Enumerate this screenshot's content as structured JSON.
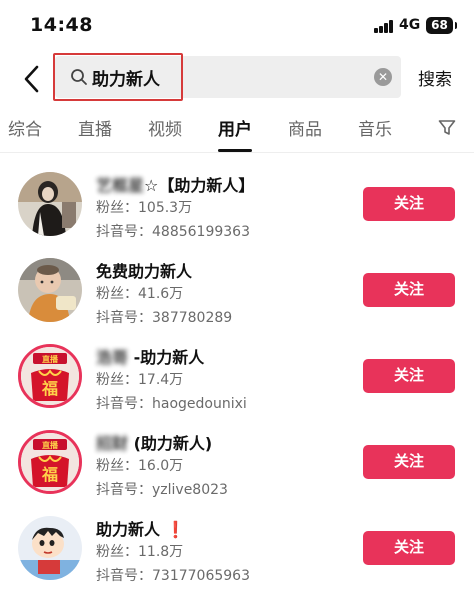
{
  "status_bar": {
    "time": "14:48",
    "network": "4G",
    "battery": "68"
  },
  "search": {
    "query": "助力新人",
    "action_label": "搜索"
  },
  "tabs": [
    {
      "label": "综合",
      "active": false
    },
    {
      "label": "直播",
      "active": false
    },
    {
      "label": "视频",
      "active": false
    },
    {
      "label": "用户",
      "active": true
    },
    {
      "label": "商品",
      "active": false
    },
    {
      "label": "音乐",
      "active": false
    }
  ],
  "follow_label": "关注",
  "live_badge": "直播",
  "fu_char": "福",
  "users": [
    {
      "name_obscured": "艺框星",
      "name_suffix": "☆【助力新人】",
      "fans": "粉丝：105.3万",
      "douyin_id": "抖音号：48856199363"
    },
    {
      "name_obscured": "",
      "name_suffix": "免费助力新人",
      "fans": "粉丝：41.6万",
      "douyin_id": "抖音号：387780289"
    },
    {
      "name_obscured": "浩哥 ",
      "name_suffix": "-助力新人",
      "fans": "粉丝：17.4万",
      "douyin_id": "抖音号：haogedounixi"
    },
    {
      "name_obscured": "招财",
      "name_suffix": " (助力新人)",
      "fans": "粉丝：16.0万",
      "douyin_id": "抖音号：yzlive8023"
    },
    {
      "name_obscured": "",
      "name_suffix": "助力新人",
      "name_mark": "❗",
      "fans": "粉丝：11.8万",
      "douyin_id": "抖音号：73177065963"
    }
  ],
  "colors": {
    "accent": "#e8335a",
    "highlight_border": "#d63a3a",
    "muted_text": "#6a6a6a"
  }
}
